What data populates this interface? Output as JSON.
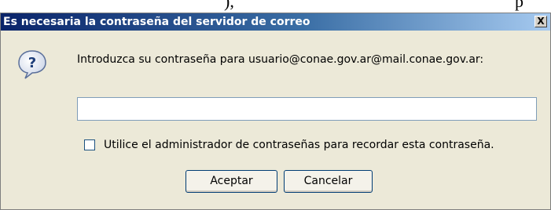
{
  "background": {
    "fragment_left": "),",
    "fragment_right": "p"
  },
  "dialog": {
    "title": "Es necesaria la contraseña del servidor de correo",
    "close_label": "X",
    "prompt": "Introduzca su contraseña para usuario@conae.gov.ar@mail.conae.gov.ar:",
    "password": {
      "value": "",
      "placeholder": ""
    },
    "remember": {
      "label": "Utilice el administrador de contraseñas para recordar esta contraseña.",
      "checked": false
    },
    "buttons": {
      "ok": "Aceptar",
      "cancel": "Cancelar"
    },
    "icon": "question-icon",
    "colors": {
      "titlebar_start": "#0a246a",
      "titlebar_end": "#a6caf0",
      "dialog_bg": "#ece9d8"
    }
  }
}
